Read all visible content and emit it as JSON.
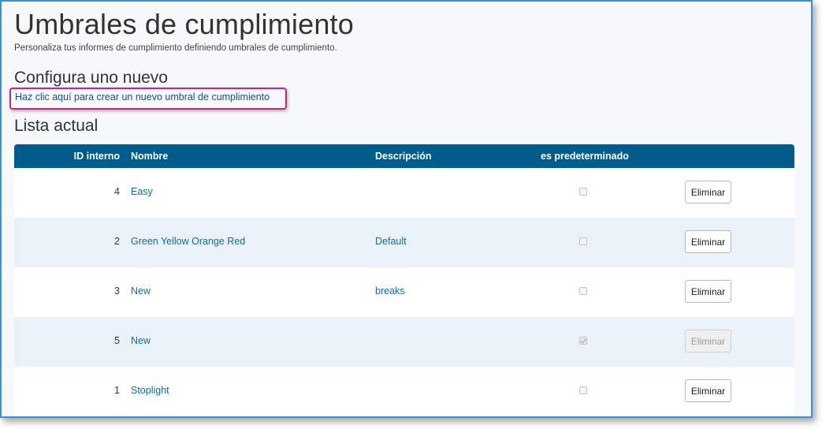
{
  "page": {
    "title": "Umbrales de cumplimiento",
    "subtitle": "Personaliza tus informes de cumplimiento definiendo umbrales de cumplimiento.",
    "section_new": "Configura uno nuevo",
    "create_link": "Haz clic aquí para crear un nuevo umbral de cumplimiento",
    "section_list": "Lista actual"
  },
  "table": {
    "headers": {
      "id": "ID interno",
      "name": "Nombre",
      "description": "Descripción",
      "default": "es predeterminado"
    },
    "rows": [
      {
        "id": "4",
        "name": "Easy",
        "description": "",
        "is_default": false,
        "action": "Eliminar",
        "action_enabled": true
      },
      {
        "id": "2",
        "name": "Green Yellow Orange Red",
        "description": "Default",
        "is_default": false,
        "action": "Eliminar",
        "action_enabled": true
      },
      {
        "id": "3",
        "name": "New",
        "description": "breaks",
        "is_default": false,
        "action": "Eliminar",
        "action_enabled": true
      },
      {
        "id": "5",
        "name": "New",
        "description": "",
        "is_default": true,
        "action": "Eliminar",
        "action_enabled": false
      },
      {
        "id": "1",
        "name": "Stoplight",
        "description": "",
        "is_default": false,
        "action": "Eliminar",
        "action_enabled": true
      }
    ]
  },
  "colors": {
    "header_bg": "#005c8a",
    "link": "#0b6ea8",
    "highlight_border": "#c2277a",
    "frame_border": "#3b8fd8"
  }
}
